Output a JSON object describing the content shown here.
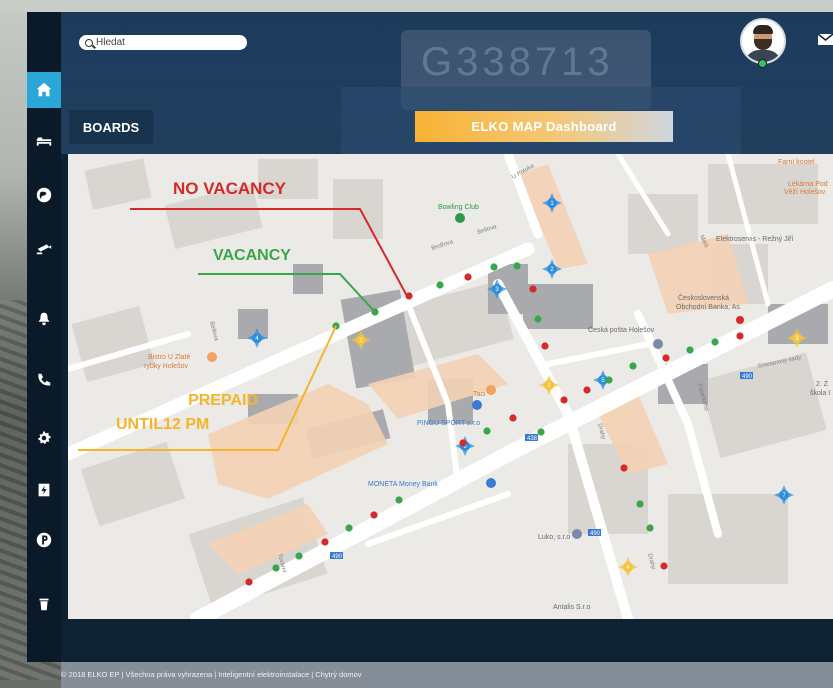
{
  "search": {
    "placeholder": "Hledat"
  },
  "header": {
    "plate_text": "G338713",
    "boards_label": "BOARDS",
    "dashboard_title": "ELKO MAP Dashboard"
  },
  "sidebar": {
    "items": [
      {
        "icon": "home-icon",
        "active": true
      },
      {
        "icon": "bed-icon"
      },
      {
        "icon": "globe-icon"
      },
      {
        "icon": "camera-icon"
      },
      {
        "icon": "bell-icon"
      },
      {
        "icon": "phone-icon"
      },
      {
        "icon": "gear-icon"
      },
      {
        "icon": "charger-icon"
      },
      {
        "icon": "parking-icon"
      },
      {
        "icon": "trash-icon"
      }
    ]
  },
  "annotations": {
    "no_vacancy": "NO VACANCY",
    "vacancy": "VACANCY",
    "prepaid_line1": "PREPAID",
    "prepaid_line2": "UNTIL12 PM"
  },
  "map": {
    "labels": {
      "bowling": "Bowling Club",
      "bistro1": "Bistro U Zlaté",
      "bistro2": "rybky Holešov",
      "posta": "Česká pošta Holešov",
      "csob1": "Československá",
      "csob2": "Obchodní Banka, As",
      "elektroservis": "Elektroservis - Režný Jiří",
      "kostel": "Farní kostel",
      "lekarna1": "Lékárna Pod",
      "lekarna2": "Věží Holešov",
      "pingu": "PINGU SPORT s.r.o",
      "taci": "Taci",
      "moneta": "MONETA Money Bank",
      "luko": "Luko, s.r.o",
      "antalis": "Antalis S.r.o",
      "skola1": "2. Z",
      "skola2": "škola I",
      "road_438": "438",
      "road_490a": "490",
      "road_490b": "490",
      "road_490c": "490",
      "street_bellova": "Bellova",
      "street_smetanovy": "Smetanovy sady",
      "street_upotoka": "U Potoka",
      "street_palackeho": "Palackého",
      "street_drahy": "Drahy",
      "street_mala": "Malá",
      "street_tovarni": "Tovární",
      "street_bezova": "Bedřova"
    },
    "colors": {
      "vacancy": "#38a64a",
      "no_vacancy": "#d42a2a",
      "prepaid": "#f5c43a",
      "node": "#2a8fe0"
    },
    "markers_blue": [
      "1",
      "2",
      "3",
      "4",
      "5",
      "6",
      "7"
    ],
    "markers_yellow": [
      "1",
      "2",
      "3",
      "4",
      "5"
    ]
  },
  "footer": {
    "text": "© 2018 ELKO EP | Všechna práva vyhrazena | Inteligentní elektroinstalace | Chytrý domov"
  }
}
